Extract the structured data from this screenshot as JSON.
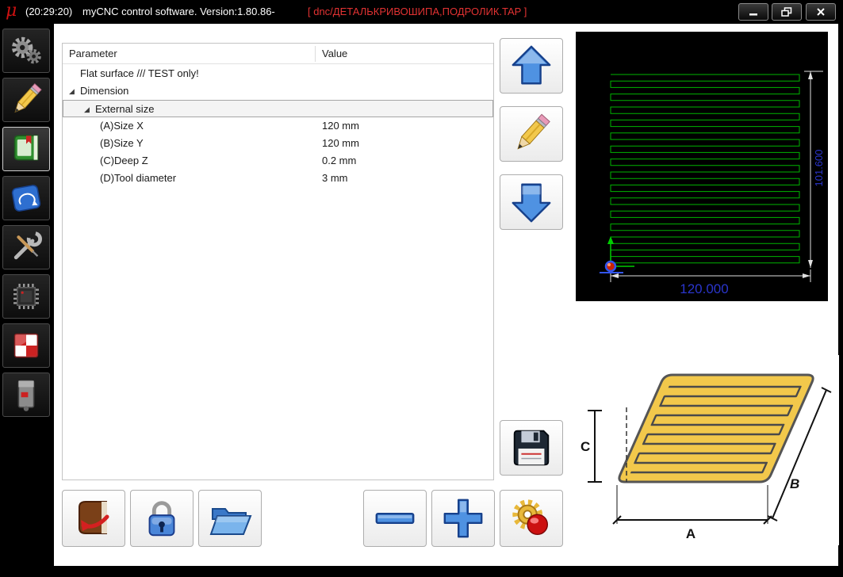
{
  "titlebar": {
    "logo": "μ",
    "time": "(20:29:20)",
    "app_title": "myCNC control software. Version:1.80.86-",
    "file_label": "[ dnc/ДЕТАЛЬКРИВОШИПА,ПОДРОЛИК.TAP ]"
  },
  "sidebar": {
    "items": [
      {
        "id": "settings",
        "icon": "gears-icon"
      },
      {
        "id": "edit",
        "icon": "pencil-icon"
      },
      {
        "id": "program",
        "icon": "book-icon",
        "selected": true
      },
      {
        "id": "mycnc",
        "icon": "mycnc-tile-icon"
      },
      {
        "id": "tools",
        "icon": "wrench-icon"
      },
      {
        "id": "hardware",
        "icon": "chip-icon"
      },
      {
        "id": "diagnostics",
        "icon": "checkered-icon"
      },
      {
        "id": "motor",
        "icon": "motor-icon"
      }
    ]
  },
  "parameters": {
    "columns": [
      "Parameter",
      "Value"
    ],
    "rows": [
      {
        "label": "Flat surface /// TEST only!",
        "value": "",
        "indent": 0,
        "expanded": null,
        "selected": false
      },
      {
        "label": "Dimension",
        "value": "",
        "indent": 0,
        "expanded": true,
        "selected": false
      },
      {
        "label": "External size",
        "value": "",
        "indent": 1,
        "expanded": true,
        "selected": true
      },
      {
        "label": "(A)Size X",
        "value": "120 mm",
        "indent": 2,
        "expanded": null,
        "selected": false
      },
      {
        "label": "(B)Size Y",
        "value": "120 mm",
        "indent": 2,
        "expanded": null,
        "selected": false
      },
      {
        "label": "(C)Deep Z",
        "value": "0.2 mm",
        "indent": 2,
        "expanded": null,
        "selected": false
      },
      {
        "label": "(D)Tool diameter",
        "value": "3 mm",
        "indent": 2,
        "expanded": null,
        "selected": false
      }
    ]
  },
  "preview": {
    "width_dim": "120.000",
    "height_dim": "101.600",
    "path_color": "#00b400",
    "dim_color": "#2a35cc"
  },
  "illustration": {
    "label_a": "A",
    "label_b": "B",
    "label_c": "C",
    "plate_color": "#f2c84b"
  },
  "colors": {
    "titlebar_bg": "#000000",
    "accent_red": "#cc2222",
    "arrow_blue": "#4f92e2"
  }
}
